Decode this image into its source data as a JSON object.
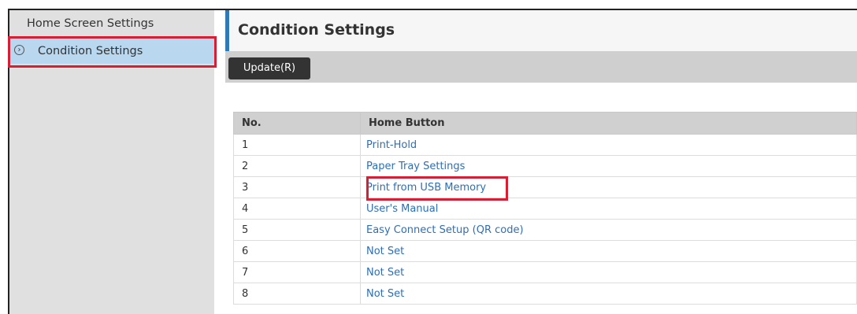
{
  "sidebar": {
    "items": [
      {
        "label": "Home Screen Settings"
      },
      {
        "label": "Condition Settings",
        "selected": true,
        "icon": "chevron-circle-right-icon"
      }
    ]
  },
  "header": {
    "title": "Condition Settings"
  },
  "toolbar": {
    "update_label": "Update(R)"
  },
  "table": {
    "columns": [
      "No.",
      "Home Button"
    ],
    "rows": [
      {
        "no": "1",
        "button": "Print-Hold"
      },
      {
        "no": "2",
        "button": "Paper Tray Settings"
      },
      {
        "no": "3",
        "button": "Print from USB Memory"
      },
      {
        "no": "4",
        "button": "User's Manual"
      },
      {
        "no": "5",
        "button": "Easy Connect Setup (QR code)"
      },
      {
        "no": "6",
        "button": "Not Set"
      },
      {
        "no": "7",
        "button": "Not Set"
      },
      {
        "no": "8",
        "button": "Not Set"
      }
    ]
  },
  "colors": {
    "accent": "#2f79b9",
    "highlight": "#d51f35",
    "selected_bg": "#b9d8ef",
    "link": "#2c6fb7",
    "button_bg": "#333333"
  }
}
